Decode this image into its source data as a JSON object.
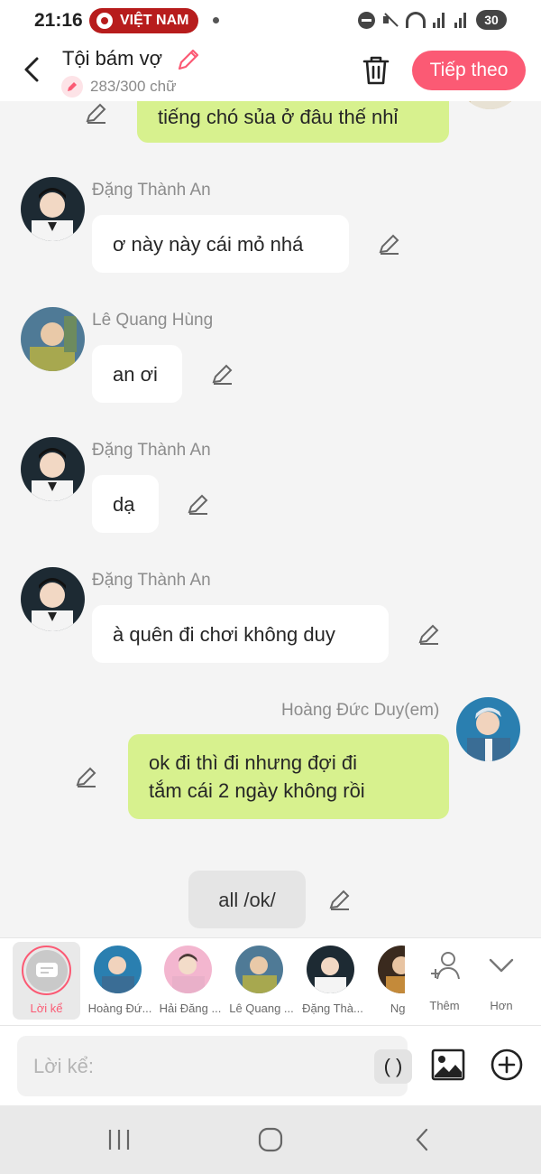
{
  "status_bar": {
    "time": "21:16",
    "country_badge": "VIỆT NAM",
    "battery": "30",
    "icons": [
      "dnd-icon",
      "mute-icon",
      "wifi-icon",
      "signal-icon",
      "battery-icon"
    ]
  },
  "header": {
    "title": "Tội bám vợ",
    "char_count": "283/300 chữ",
    "next_label": "Tiếp theo",
    "accent": "#fb5a74"
  },
  "messages": [
    {
      "side": "right",
      "sender": "",
      "text": "tiếng chó sủa ở đâu thế nhỉ"
    },
    {
      "side": "left",
      "sender": "Đặng Thành An",
      "text": "ơ này này cái mỏ nhá"
    },
    {
      "side": "left",
      "sender": "Lê Quang Hùng",
      "text": "an ơi"
    },
    {
      "side": "left",
      "sender": "Đặng Thành An",
      "text": "dạ"
    },
    {
      "side": "left",
      "sender": "Đặng Thành An",
      "text": "à quên đi chơi không duy"
    },
    {
      "side": "right",
      "sender": "Hoàng Đức Duy(em)",
      "text_line1": "ok đi thì đi nhưng đợi đi",
      "text_line2": "tắm cái 2 ngày không rồi"
    },
    {
      "side": "center",
      "sender": "",
      "text": "all /ok/"
    }
  ],
  "character_bar": {
    "narration_label": "Lời kể",
    "characters": [
      "Hoàng Đứ...",
      "Hải Đăng ...",
      "Lê Quang ...",
      "Đặng Thà...",
      "Nguy"
    ],
    "add_label": "Thêm",
    "more_label": "Hơn"
  },
  "input": {
    "placeholder": "Lời kể:",
    "paren_label": "( )"
  },
  "colors": {
    "bubble_right": "#d7f18e",
    "bubble_left": "#ffffff",
    "status_badge": "#b71c1c"
  }
}
